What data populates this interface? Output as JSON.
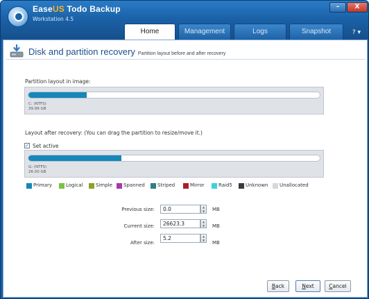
{
  "app": {
    "title_prefix": "Ease",
    "title_brand": "US",
    "title_suffix": " Todo Backup",
    "subtitle": "Workstation 4.5"
  },
  "window_buttons": {
    "minimize": "–",
    "close": "X"
  },
  "tabs": [
    {
      "label": "Home",
      "active": true
    },
    {
      "label": "Management",
      "active": false
    },
    {
      "label": "Logs",
      "active": false
    },
    {
      "label": "Snapshot",
      "active": false
    }
  ],
  "help_label": "? ▾",
  "page": {
    "heading": "Disk and partition recovery",
    "subheading": "Partition layout before and after recovery"
  },
  "image_layout": {
    "label": "Partition layout in image:",
    "partition_name": "C: (NTFS)",
    "partition_size": "39.99 GB",
    "fill_fraction": 0.2
  },
  "after_layout": {
    "label": "Layout after recovery: (You can drag the partition to resize/move it.)",
    "set_active_label": "Set active",
    "set_active_checked": true,
    "partition_name": "G: (NTFS)",
    "partition_size": "26.00 GB",
    "fill_fraction": 0.32
  },
  "legend": [
    {
      "label": "Primary",
      "color": "#1687b8"
    },
    {
      "label": "Logical",
      "color": "#7cc242"
    },
    {
      "label": "Simple",
      "color": "#8fa02c"
    },
    {
      "label": "Spanned",
      "color": "#a63aa8"
    },
    {
      "label": "Striped",
      "color": "#2d7f82"
    },
    {
      "label": "Mirror",
      "color": "#a81f2a"
    },
    {
      "label": "Raid5",
      "color": "#3fd0e0"
    },
    {
      "label": "Unknown",
      "color": "#3b3b3b"
    },
    {
      "label": "Unallocated",
      "color": "#d8d8d8"
    }
  ],
  "sizes": {
    "previous": {
      "label": "Previous size:",
      "value": "0.0",
      "unit": "MB"
    },
    "current": {
      "label": "Current size:",
      "value": "26623.3",
      "unit": "MB"
    },
    "after": {
      "label": "After size:",
      "value": "5.2",
      "unit": "MB"
    }
  },
  "buttons": {
    "back_mn": "B",
    "back_rest": "ack",
    "next_mn": "N",
    "next_rest": "ext",
    "cancel_mn": "C",
    "cancel_rest": "ancel"
  }
}
